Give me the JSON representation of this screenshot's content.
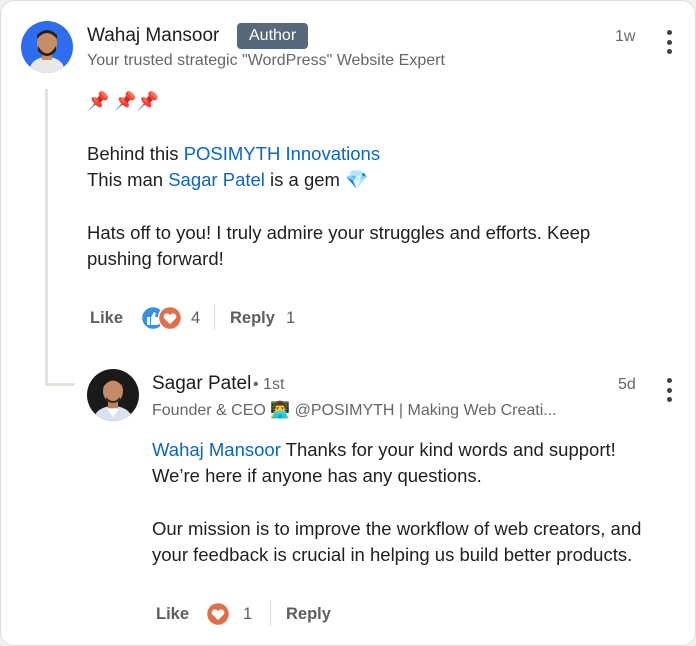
{
  "comment": {
    "author": "Wahaj Mansoor",
    "badge": "Author",
    "headline": "Your trusted strategic \"WordPress\" Website Expert",
    "time": "1w",
    "emoji_line": "📌 📌📌",
    "line1_prefix": "Behind this ",
    "line1_link": "POSIMYTH Innovations",
    "line2_prefix": "This man ",
    "line2_link": "Sagar Patel",
    "line2_suffix": " is a gem 💎",
    "paragraph_1": "Hats off to you! I truly admire your struggles and efforts. Keep",
    "paragraph_2": "pushing forward!",
    "like_label": "Like",
    "reaction_count": "4",
    "reply_label": "Reply",
    "reply_count": "1"
  },
  "reply": {
    "author": "Sagar Patel",
    "degree": " • 1st",
    "headline": "Founder & CEO 👨‍💻 @POSIMYTH | Making Web Creati...",
    "time": "5d",
    "mention": "Wahaj Mansoor",
    "text_1": " Thanks for your kind words and support!",
    "text_2": "We’re here if anyone has any questions.",
    "text_3": "Our mission is to improve the workflow of web creators, and",
    "text_4": "your feedback is crucial in helping us build better products.",
    "like_label": "Like",
    "reaction_count": "1",
    "reply_label": "Reply"
  },
  "colors": {
    "link": "#0a66c2",
    "badge_bg": "#56687a",
    "like_blue": "#378fe9",
    "love_red": "#df704d"
  }
}
